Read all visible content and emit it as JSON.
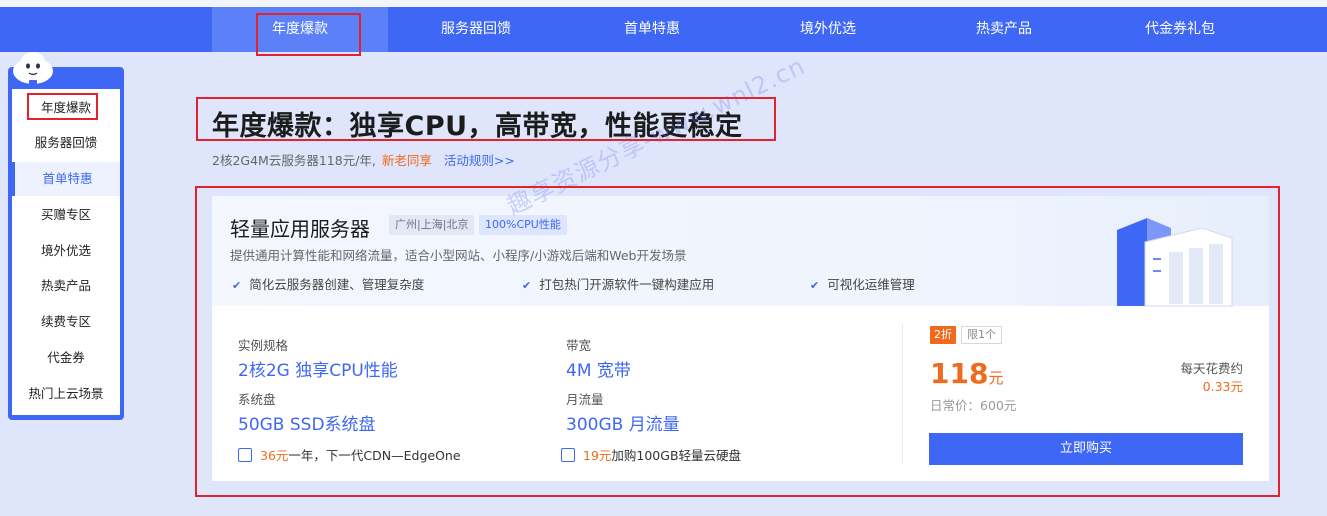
{
  "topnav": {
    "tabs": [
      "年度爆款",
      "服务器回馈",
      "首单特惠",
      "境外优选",
      "热卖产品",
      "代金券礼包"
    ],
    "active_index": 0
  },
  "sidebar": {
    "items": [
      "年度爆款",
      "服务器回馈",
      "首单特惠",
      "买赠专区",
      "境外优选",
      "热卖产品",
      "续费专区",
      "代金券",
      "热门上云场景"
    ],
    "active_index": 2
  },
  "hero": {
    "title": "年度爆款：独享CPU，高带宽，性能更稳定",
    "sub_text": "2核2G4M云服务器118元/年,",
    "sub_highlight": "新老同享",
    "sub_link": "活动规则>>"
  },
  "watermark": "趣享资源分享-www.wnl2.cn",
  "card": {
    "title": "轻量应用服务器",
    "tags": [
      "广州|上海|北京",
      "100%CPU性能"
    ],
    "description": "提供通用计算性能和网络流量，适合小型网站、小程序/小游戏后端和Web开发场景",
    "features": [
      "简化云服务器创建、管理复杂度",
      "打包热门开源软件一键构建应用",
      "可视化运维管理"
    ],
    "specs": [
      {
        "label": "实例规格",
        "value": "2核2G 独享CPU性能"
      },
      {
        "label": "带宽",
        "value": "4M 宽带"
      },
      {
        "label": "系统盘",
        "value": "50GB SSD系统盘"
      },
      {
        "label": "月流量",
        "value": "300GB 月流量"
      }
    ],
    "addons": [
      {
        "price": "36元",
        "text": "一年，下一代CDN—EdgeOne"
      },
      {
        "price": "19元",
        "text": "加购100GB轻量云硬盘"
      }
    ],
    "discount_badge": "2折",
    "limit_badge": "限1个",
    "price": "118",
    "price_unit": "元",
    "original_price": "日常价：600元",
    "daily_label": "每天花费约",
    "daily_value": "0.33元",
    "buy_label": "立即购买"
  },
  "colors": {
    "brand_blue": "#3f67f5",
    "accent_orange": "#f06a1d",
    "annotation_red": "#e2232d",
    "page_bg": "#dfe6fb"
  }
}
